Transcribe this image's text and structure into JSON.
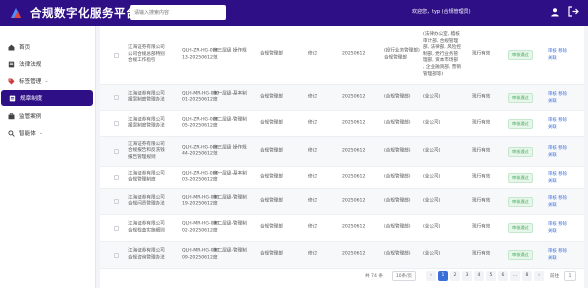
{
  "header": {
    "title": "合规数字化服务平台",
    "search_placeholder": "请输入搜索内容",
    "welcome": "欢迎您，typ (合规管理员)",
    "colors": {
      "primary": "#2e0f86"
    }
  },
  "sidebar": {
    "items": [
      {
        "label": "首页",
        "icon": "home-icon"
      },
      {
        "label": "法律法规",
        "icon": "law-icon"
      },
      {
        "label": "标签管理",
        "icon": "tag-icon",
        "caret": "⌄"
      },
      {
        "label": "规章制度",
        "icon": "document-icon",
        "active": true
      },
      {
        "label": "监管案例",
        "icon": "case-icon"
      },
      {
        "label": "智能体",
        "icon": "search-icon",
        "caret": "⌄"
      }
    ]
  },
  "table": {
    "rows": [
      {
        "company": "江海证券有限公司\n公司合规总部特别\n合规工作指引",
        "code": "QLH-ZR-HG-000\n13-20250612",
        "level": "第三层级 操作规\n范",
        "dept": "合规管理部",
        "action": "修订",
        "date": "20250612",
        "scope": "(投行业务管理部)\n合规管理部",
        "related": "(法律办公室, 稽核\n审计部, 合规管理\n部, 法律部, 风险控\n制部, 党行业务管\n理部, 资本市场部\n, 企业融资部, 营销\n管理部等)",
        "status": "现行有效",
        "badge": "审核通过",
        "ops": [
          "审核",
          "移除"
        ],
        "ops2": [
          "关联",
          ""
        ]
      },
      {
        "company": "江海证券有限公司\n报案制度管理办法",
        "code": "QLH-MR-HG-000\n01-20250612",
        "level": "第一层级-基本制\n度",
        "dept": "合规管理部",
        "action": "修订",
        "date": "20250612",
        "scope": "(合规管理部)",
        "related": "(全公司)",
        "status": "现行有效",
        "badge": "审核通过",
        "ops": [
          "审核",
          "移除"
        ],
        "ops2": [
          "关联",
          ""
        ]
      },
      {
        "company": "江海证券有限公司\n报案制度管理办法",
        "code": "QLH-ZR-HG-000\n05-20250612",
        "level": "第二层级-管理制\n度",
        "dept": "合规管理部",
        "action": "修订",
        "date": "20250612",
        "scope": "(合规管理部)",
        "related": "(全公司)",
        "status": "现行有效",
        "badge": "审核通过",
        "ops": [
          "审核",
          "移除"
        ],
        "ops2": [
          "关联",
          ""
        ]
      },
      {
        "company": "江海证券有限公司\n合规报告和反洗钱\n报告管理规则",
        "code": "QLH-ZR-HG-000\n44-20250612",
        "level": "第三层级 操作规\n范",
        "dept": "合规管理部",
        "action": "修订",
        "date": "20250612",
        "scope": "(合规管理部)",
        "related": "(全公司)",
        "status": "现行有效",
        "badge": "审核通过",
        "ops": [
          "审核",
          "移除"
        ],
        "ops2": [
          "关联",
          ""
        ]
      },
      {
        "company": "江海证券有限公司\n合规管理制度",
        "code": "QLH-ZR-HG-000\n03-20250612",
        "level": "第一层级-基本制\n度",
        "dept": "合规管理部",
        "action": "修订",
        "date": "20250612",
        "scope": "(合规管理部)",
        "related": "(全公司)",
        "status": "现行有效",
        "badge": "审核通过",
        "ops": [
          "审核",
          "移除"
        ],
        "ops2": [
          "关联",
          ""
        ]
      },
      {
        "company": "江海证券有限公司\n合规问责管理办法",
        "code": "QLH-MR-HG-000\n19-20250612",
        "level": "第二层级-管理制\n度",
        "dept": "合规管理部",
        "action": "修订",
        "date": "20250612",
        "scope": "(合规管理部)",
        "related": "(全公司)",
        "status": "现行有效",
        "badge": "审核通过",
        "ops": [
          "审核",
          "移除"
        ],
        "ops2": [
          "关联",
          ""
        ]
      },
      {
        "company": "江海证券有限公司\n合规检查实施细则",
        "code": "QLH-MR-HG-000\n02-20250612",
        "level": "第二层级-管理制\n度",
        "dept": "合规管理部",
        "action": "修订",
        "date": "20250612",
        "scope": "(合规管理部)",
        "related": "(全公司)",
        "status": "现行有效",
        "badge": "审核通过",
        "ops": [
          "审核",
          "移除"
        ],
        "ops2": [
          "关联",
          ""
        ]
      },
      {
        "company": "江海证券有限公司\n合规咨询管理办法",
        "code": "QLH-MR-HG-000\n09-20250612",
        "level": "第二层级-管理制\n度",
        "dept": "合规管理部",
        "action": "修订",
        "date": "20250612",
        "scope": "(合规管理部)",
        "related": "(全公司)",
        "status": "现行有效",
        "badge": "审核通过",
        "ops": [
          "审核",
          "移除"
        ],
        "ops2": [
          "关联",
          ""
        ]
      }
    ]
  },
  "pagination": {
    "total": "共 74 条",
    "page_size": "10条/页",
    "prev": "‹",
    "pages": [
      "1",
      "2",
      "3",
      "4",
      "5",
      "6",
      "...",
      "8"
    ],
    "next": "›",
    "active_page": "1",
    "goto_label": "前往",
    "goto_value": "1"
  }
}
